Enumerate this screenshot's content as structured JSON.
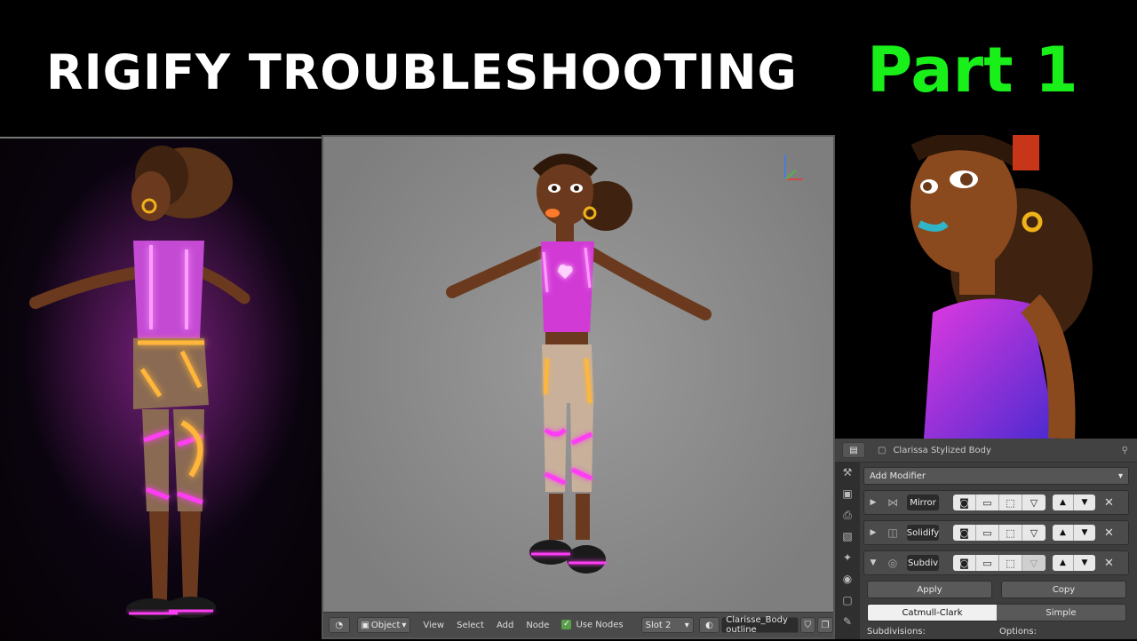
{
  "banner": {
    "title": "RIGIFY TROUBLESHOOTING",
    "part": "Part 1",
    "part_color": "#19f01a"
  },
  "viewport": {
    "header": {
      "mode_label": "Object",
      "menu": [
        "View",
        "Select",
        "Add",
        "Node"
      ],
      "use_nodes_label": "Use Nodes",
      "use_nodes_checked": true,
      "slot_label": "Slot 2",
      "material_name": "Clarisse_Body outline"
    }
  },
  "properties": {
    "object_name": "Clarissa Stylized Body",
    "add_modifier_label": "Add Modifier",
    "modifiers": [
      {
        "name": "Mirror",
        "expanded": false
      },
      {
        "name": "Solidify",
        "expanded": false
      },
      {
        "name": "Subdiv",
        "expanded": true
      }
    ],
    "apply_label": "Apply",
    "copy_label": "Copy",
    "subdiv_types": [
      "Catmull-Clark",
      "Simple"
    ],
    "active_subdiv_type": "Catmull-Clark",
    "subdivisions_label": "Subdivisions:",
    "options_label": "Options:"
  },
  "colors": {
    "neon_pink": "#ff3df5",
    "neon_orange": "#ffb63a",
    "skin": "#6b3a1e",
    "top_magenta": "#d23ad6"
  }
}
